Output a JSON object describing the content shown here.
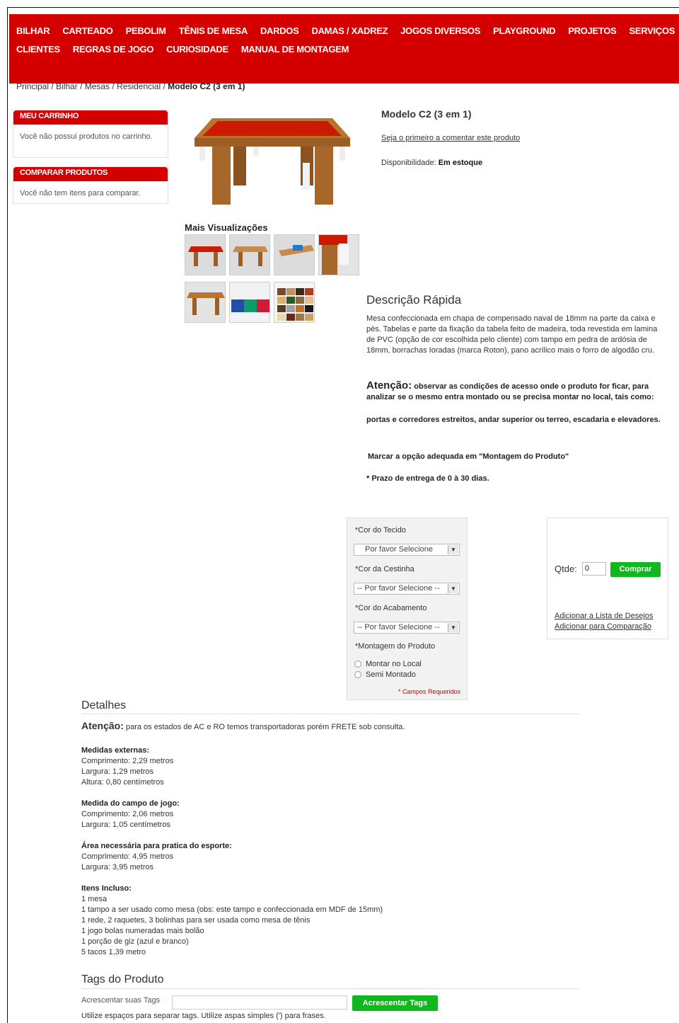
{
  "nav": {
    "row1": [
      "BILHAR",
      "CARTEADO",
      "PEBOLIM",
      "TÊNIS DE MESA",
      "DARDOS",
      "DAMAS / XADREZ",
      "JOGOS DIVERSOS",
      "PLAYGROUND",
      "PROJETOS",
      "SERVIÇOS"
    ],
    "row2": [
      "CLIENTES",
      "REGRAS DE JOGO",
      "CURIOSIDADE",
      "MANUAL DE MONTAGEM"
    ]
  },
  "breadcrumb": {
    "items": [
      "Principal",
      "Bilhar",
      "Mesas",
      "Residencial"
    ],
    "sep": " / ",
    "current": "Modelo C2 (3 em 1)"
  },
  "sidebar": {
    "cart_title": "MEU CARRINHO",
    "cart_text": "Você não possui produtos no carrinho.",
    "compare_title": "COMPARAR PRODUTOS",
    "compare_text": "Você não tem itens para comparar."
  },
  "product": {
    "title": "Modelo C2 (3 em 1)",
    "review_link": "Seja o primeiro a comentar este produto",
    "availability_label": "Disponibilidade: ",
    "availability_value": "Em estoque",
    "more_views": "Mais Visualizações",
    "desc_title": "Descrição Rápida",
    "desc_text": "Mesa confeccionada em chapa de compensado naval de 18mm na parte da caixa e pés. Tabelas e parte da fixação da tabela feito de madeira, toda revestida em lamina de PVC (opção de cor escolhida pelo cliente) com tampo em pedra de ardósia de 18mm, borrachas Ioradas (marca Roton), pano acrílico mais o forro de algodão cru.",
    "attn_word": "Atenção:",
    "attn_text": " observar as condições de acesso onde o produto for ficar, para analizar se o mesmo entra montado ou se precisa montar no local, tais como:",
    "attn_text2": "portas e corredores estreitos, andar superior ou terreo, escadaria e elevadores.",
    "attn_text3": "Marcar a opção adequada em \"Montagem do Produto\"",
    "attn_text4": "* Prazo de entrega de 0 à 30 dias."
  },
  "options": {
    "tecido_label": "*Cor do Tecido",
    "tecido_value": "Por favor Selecione",
    "cestinha_label": "*Cor da Cestinha",
    "cestinha_value": "-- Por favor Selecione --",
    "acabamento_label": "*Cor do Acabamento",
    "acabamento_value": "-- Por favor Selecione --",
    "montagem_label": "*Montagem do Produto",
    "radio1": "Montar no Local",
    "radio2": "Semi Montado",
    "required": "* Campos Requeridos"
  },
  "buy": {
    "qty_label": "Qtde:",
    "qty_value": "0",
    "buy_button": "Comprar",
    "wishlist_link": "Adicionar a Lista de Desejos",
    "compare_link": "Adicionar para Comparação"
  },
  "details": {
    "title": "Detalhes",
    "attn_word": "Atenção:",
    "attn_text": " para os estados de AC e RO temos transportadoras porém FRETE sob consulta.",
    "ext_title": "Medidas externas:",
    "ext_lines": [
      "Comprimento: 2,29 metros",
      "Largura: 1,29 metros",
      "Altura: 0,80 centímetros"
    ],
    "field_title": "Medida do campo de jogo:",
    "field_lines": [
      "Comprimento: 2,06 metros",
      "Largura: 1,05 centímetros"
    ],
    "area_title": "Área necessária para pratica do esporte:",
    "area_lines": [
      "Comprimento: 4,95 metros",
      "Largura: 3,95 metros"
    ],
    "items_title": "Itens Incluso:",
    "items_lines": [
      "1 mesa",
      "1 tampo a ser usado como mesa (obs: este tampo e confeccionada em MDF de 15mm)",
      "1 rede, 2 raquetes, 3 bolinhas para ser usada como mesa de tênis",
      "1 jogo bolas numeradas mais bolão",
      "1 porção de giz (azul e branco)",
      "5 tacos 1,39 metro"
    ]
  },
  "tags": {
    "title": "Tags do Produto",
    "label": "Acrescentar suas Tags",
    "button": "Acrescentar Tags",
    "hint": "Utilize espaços para separar tags. Utilize aspas simples (') para frases."
  }
}
